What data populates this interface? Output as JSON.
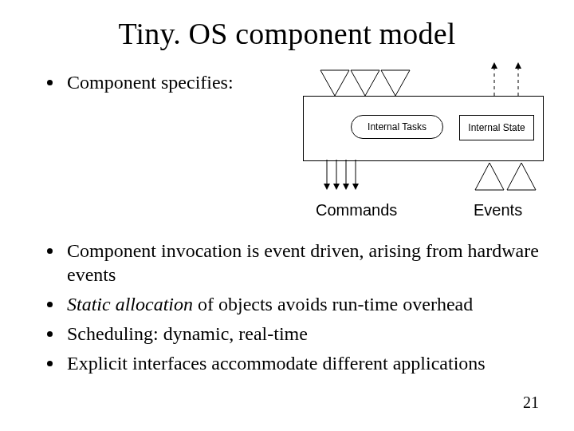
{
  "title": "Tiny. OS component model",
  "bullets": [
    {
      "text": "Component specifies:"
    },
    {
      "text": "Component invocation is event driven, arising from hardware events"
    },
    {
      "prefix_italic": "Static allocation",
      "rest": " of objects avoids run-time overhead"
    },
    {
      "text": "Scheduling: dynamic, real-time"
    },
    {
      "text": "Explicit interfaces accommodate different applications"
    }
  ],
  "diagram": {
    "internal_tasks": "Internal Tasks",
    "internal_state": "Internal State",
    "commands_label": "Commands",
    "events_label": "Events"
  },
  "page_number": "21"
}
